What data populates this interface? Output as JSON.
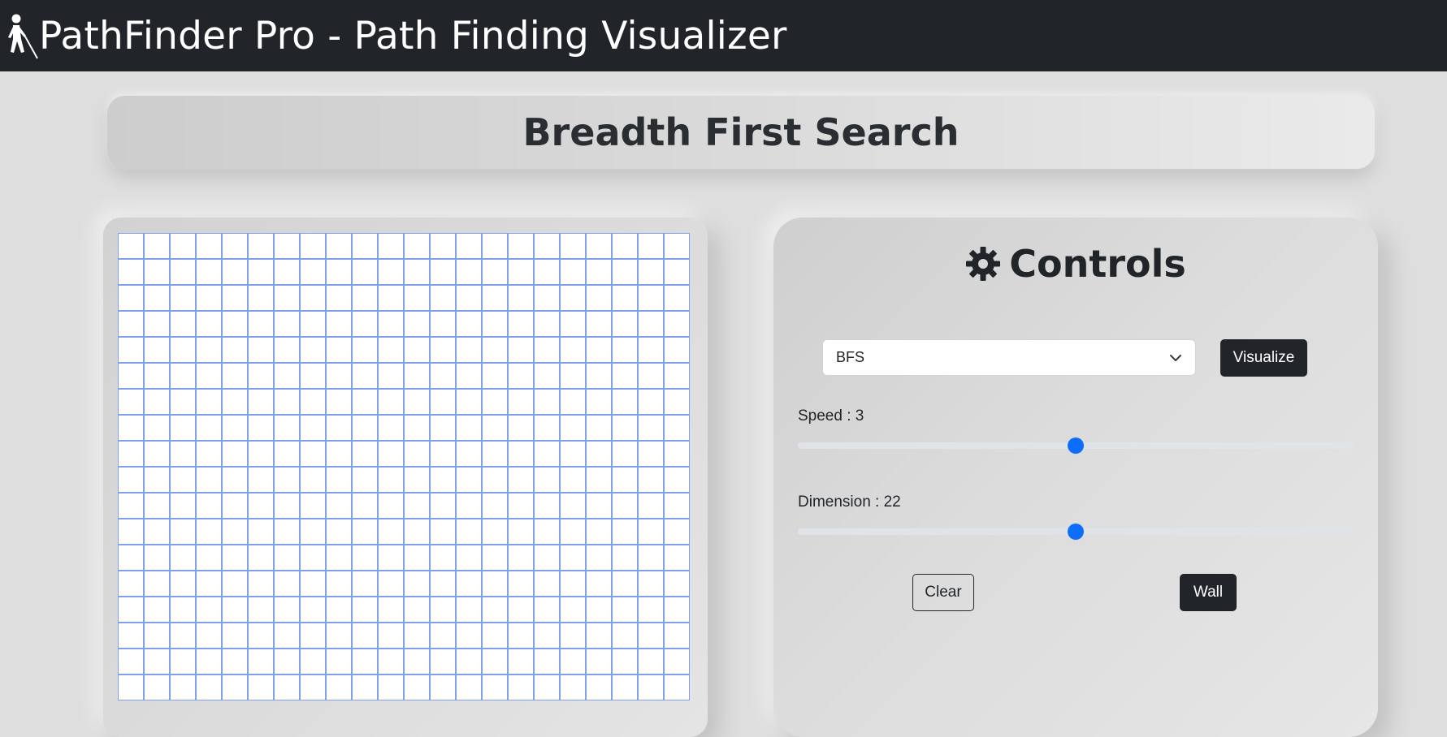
{
  "navbar": {
    "icon": "blind-walker-icon",
    "brand": "PathFinder Pro - Path Finding Visualizer"
  },
  "header": {
    "algorithm_title": "Breadth First Search"
  },
  "grid": {
    "columns": 22,
    "visible_rows": 18,
    "cell_fill": "#ffffff",
    "cell_border": "#7fa3e6"
  },
  "controls": {
    "icon": "gear-icon",
    "title": "Controls",
    "algorithm_select": {
      "selected": "BFS"
    },
    "visualize_label": "Visualize",
    "speed": {
      "label": "Speed : 3",
      "value": 3,
      "position_fraction": 0.5
    },
    "dimension": {
      "label": "Dimension : 22",
      "value": 22,
      "position_fraction": 0.5
    },
    "clear_label": "Clear",
    "wall_label": "Wall"
  },
  "colors": {
    "navbar_bg": "#212529",
    "accent": "#0d6efd",
    "page_bg": "#dedede"
  }
}
